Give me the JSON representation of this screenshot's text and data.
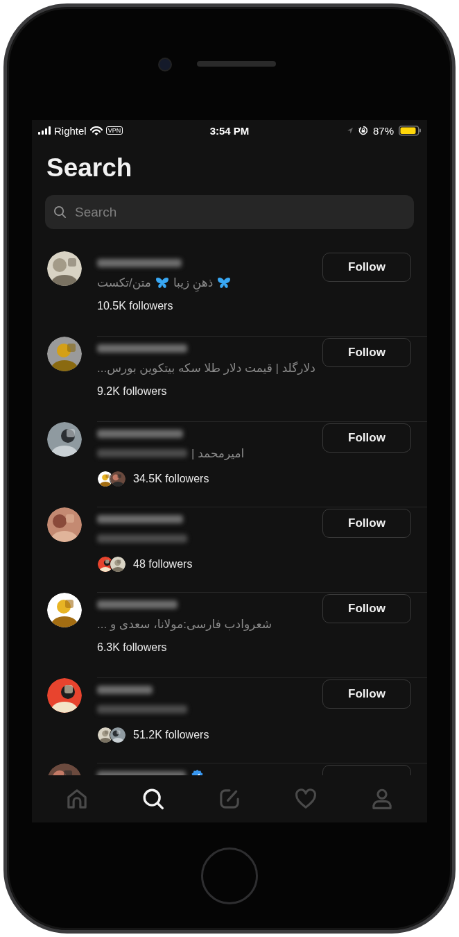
{
  "status_bar": {
    "carrier": "Rightel",
    "vpn": "VPN",
    "time": "3:54 PM",
    "battery": "87%"
  },
  "title": "Search",
  "search": {
    "placeholder": "Search"
  },
  "results": [
    {
      "bio": [
        {
          "kind": "butterfly"
        },
        {
          "kind": "text",
          "text": "ذهنِ زیبا"
        },
        {
          "kind": "butterfly"
        },
        {
          "kind": "text",
          "text": "متن/تکست"
        }
      ],
      "followers": "10.5K followers",
      "mutuals": false,
      "verified": false,
      "button": "Follow"
    },
    {
      "bio": [
        {
          "kind": "text",
          "text": "دلارگلد | قیمت دلار طلا سکه بیتکوین بورس..."
        }
      ],
      "followers": "9.2K followers",
      "mutuals": false,
      "verified": false,
      "button": "Follow"
    },
    {
      "bio": [
        {
          "kind": "text",
          "text": "امیرمحمد |"
        },
        {
          "kind": "blurred"
        }
      ],
      "followers": "34.5K followers",
      "mutuals": true,
      "verified": false,
      "button": "Follow"
    },
    {
      "bio": [
        {
          "kind": "blurred"
        }
      ],
      "followers": "48 followers",
      "mutuals": true,
      "verified": false,
      "button": "Follow"
    },
    {
      "bio": [
        {
          "kind": "text",
          "text": "شعروادب فارسی:مولانا، سعدی و ..."
        }
      ],
      "followers": "6.3K followers",
      "mutuals": false,
      "verified": false,
      "button": "Follow"
    },
    {
      "bio": [
        {
          "kind": "blurred"
        }
      ],
      "followers": "51.2K followers",
      "mutuals": true,
      "verified": false,
      "button": "Follow"
    },
    {
      "verified": true
    }
  ],
  "tabs": [
    {
      "kind": "home",
      "selected": false
    },
    {
      "kind": "search",
      "selected": true
    },
    {
      "kind": "compose",
      "selected": false
    },
    {
      "kind": "heart",
      "selected": false
    },
    {
      "kind": "profile",
      "selected": false
    }
  ]
}
